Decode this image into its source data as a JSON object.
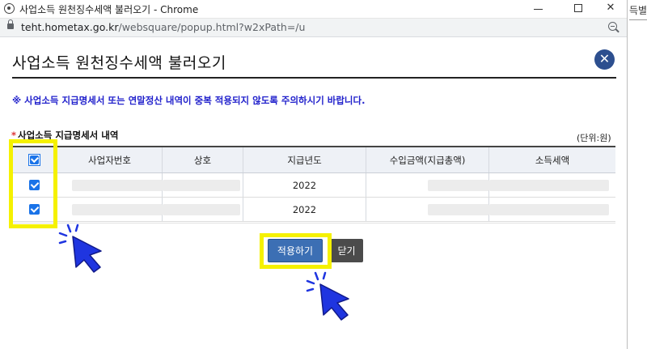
{
  "window": {
    "title": "사업소득 원천징수세액 불러오기 - Chrome",
    "url_host": "teht.hometax.go.kr",
    "url_path": "/websquare/popup.html?w2xPath=/u",
    "controls": {
      "minimize": "",
      "maximize": "",
      "close": "✕"
    }
  },
  "background_page": {
    "text": "득별서"
  },
  "popup": {
    "title": "사업소득 원천징수세액 불러오기",
    "close_glyph": "✕",
    "notice": "※ 사업소득 지급명세서 또는 연말정산 내역이 중복 적용되지 않도록 주의하시기 바랍니다.",
    "section_required_mark": "*",
    "section_label": "사업소득 지급명세서 내역",
    "unit_label": "(단위:원)",
    "table": {
      "columns": [
        "",
        "사업자번호",
        "상호",
        "지급년도",
        "수입금액(지급총액)",
        "소득세액"
      ],
      "rows": [
        {
          "checked": true,
          "year": "2022"
        },
        {
          "checked": true,
          "year": "2022"
        }
      ],
      "header_checked": true
    },
    "buttons": {
      "apply": "적용하기",
      "close": "닫기"
    }
  },
  "colors": {
    "highlight": "#f5f100",
    "checkbox": "#1a73e8",
    "apply_button": "#3c6fb4",
    "close_button": "#4b4b4b",
    "notice": "#2222cc",
    "cursor": "#1f35e0"
  },
  "icons": {
    "window_icon": "browser-icon",
    "lock": "lock-icon",
    "zoom": "zoom-icon",
    "popup_close": "close-icon",
    "pointer": "hand-pointer-icon"
  }
}
